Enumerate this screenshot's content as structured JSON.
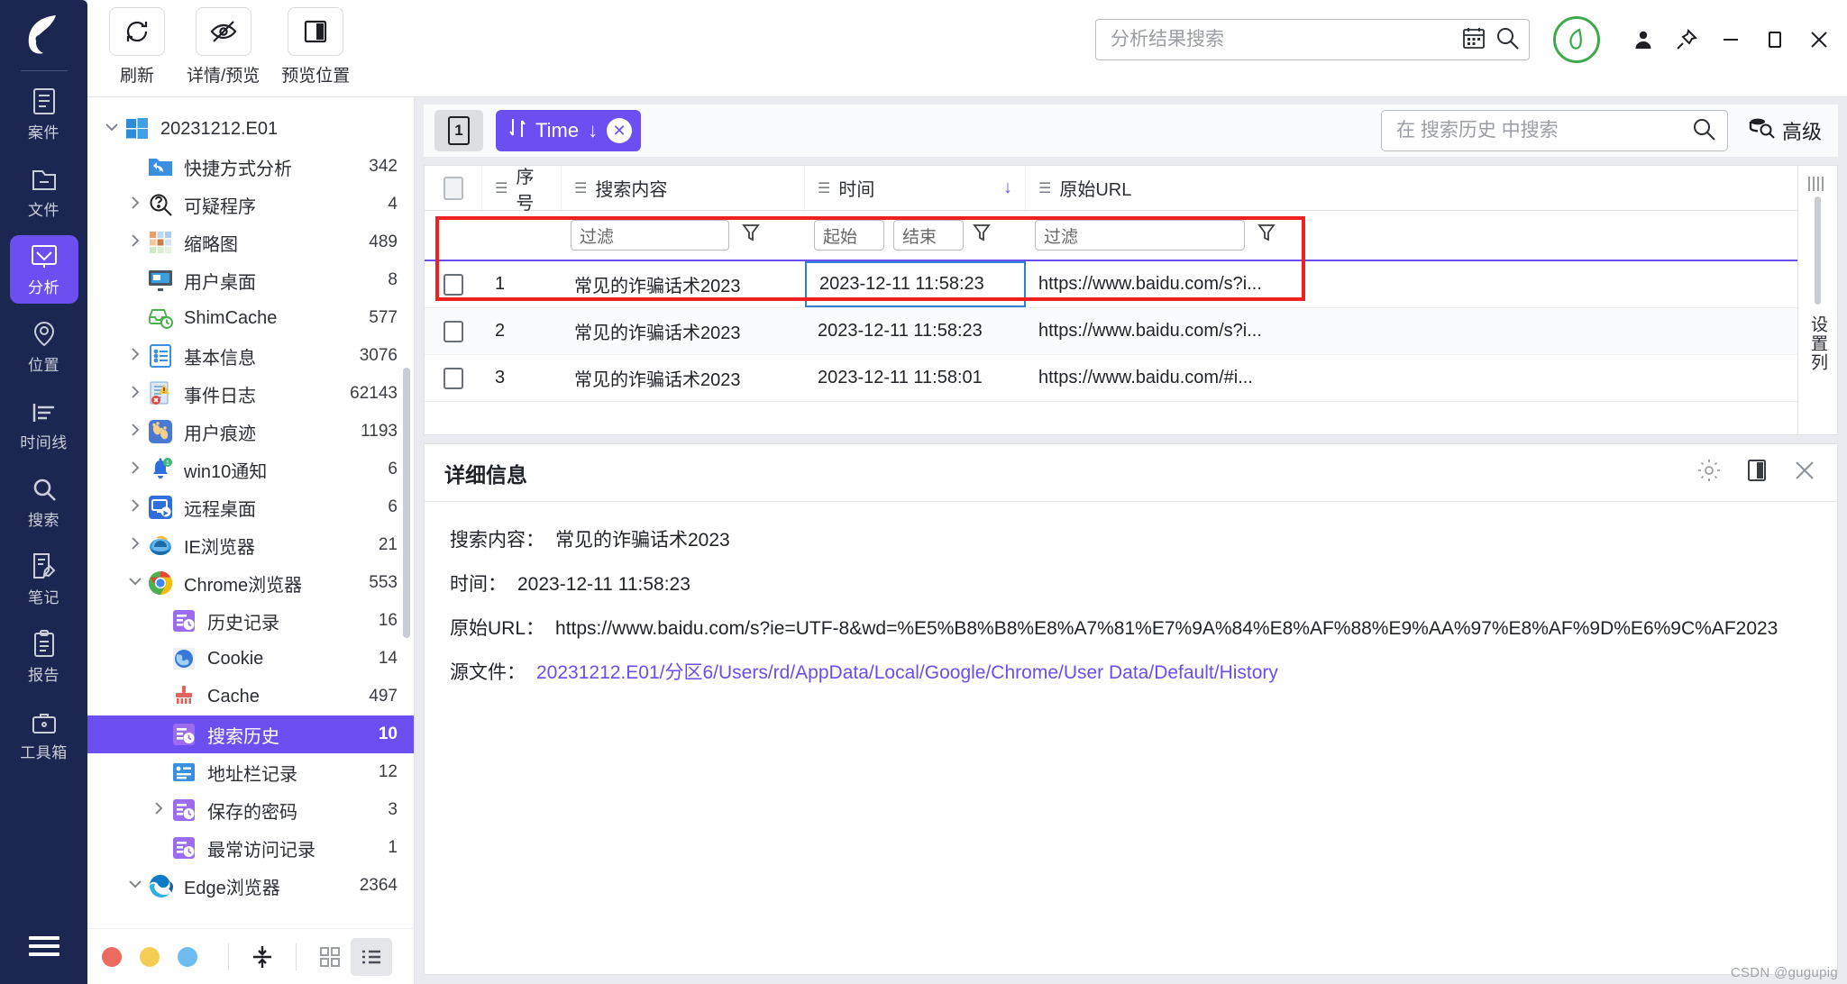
{
  "rail": {
    "logo_icon": "app-logo-icon",
    "items": [
      {
        "label": "案件",
        "icon": "clipboard-icon",
        "active": false
      },
      {
        "label": "文件",
        "icon": "folder-minus-icon",
        "active": false
      },
      {
        "label": "分析",
        "icon": "analysis-chart-icon",
        "active": true
      },
      {
        "label": "位置",
        "icon": "location-pin-icon",
        "active": false
      },
      {
        "label": "时间线",
        "icon": "timeline-icon",
        "active": false
      },
      {
        "label": "搜索",
        "icon": "search-icon",
        "active": false
      },
      {
        "label": "笔记",
        "icon": "note-pencil-icon",
        "active": false
      },
      {
        "label": "报告",
        "icon": "report-clipboard-icon",
        "active": false
      },
      {
        "label": "工具箱",
        "icon": "toolbox-icon",
        "active": false
      }
    ],
    "menu_icon": "hamburger-menu-icon"
  },
  "titlebar": {
    "tools": [
      {
        "label": "刷新",
        "icon": "refresh-icon"
      },
      {
        "label": "详情/预览",
        "icon": "eye-off-icon"
      },
      {
        "label": "预览位置",
        "icon": "panel-layout-icon"
      }
    ],
    "global_search": {
      "placeholder": "分析结果搜索",
      "value": "",
      "calendar_icon": "calendar-icon",
      "search_icon": "search-icon"
    },
    "status_icon": "green-leaf-badge-icon",
    "window_controls": [
      {
        "name": "account-icon",
        "glyph": "person"
      },
      {
        "name": "pin-icon",
        "glyph": "pin"
      },
      {
        "name": "minimize-icon",
        "glyph": "minus"
      },
      {
        "name": "maximize-icon",
        "glyph": "square"
      },
      {
        "name": "close-icon",
        "glyph": "x"
      }
    ]
  },
  "tree": {
    "nodes": [
      {
        "label": "20231212.E01",
        "count": "",
        "caret": "down",
        "indent": 0,
        "icon": "windows-icon",
        "selected": false
      },
      {
        "label": "快捷方式分析",
        "count": "342",
        "caret": "none",
        "indent": 1,
        "icon": "shortcut-folder-icon",
        "selected": false
      },
      {
        "label": "可疑程序",
        "count": "4",
        "caret": "right",
        "indent": 1,
        "icon": "suspicious-program-icon",
        "selected": false
      },
      {
        "label": "缩略图",
        "count": "489",
        "caret": "right",
        "indent": 1,
        "icon": "thumbnail-grid-icon",
        "selected": false
      },
      {
        "label": "用户桌面",
        "count": "8",
        "caret": "none",
        "indent": 1,
        "icon": "desktop-icon",
        "selected": false
      },
      {
        "label": "ShimCache",
        "count": "577",
        "caret": "none",
        "indent": 1,
        "icon": "shimcache-icon",
        "selected": false
      },
      {
        "label": "基本信息",
        "count": "3076",
        "caret": "right",
        "indent": 1,
        "icon": "basic-info-icon",
        "selected": false
      },
      {
        "label": "事件日志",
        "count": "62143",
        "caret": "right",
        "indent": 1,
        "icon": "event-log-icon",
        "selected": false
      },
      {
        "label": "用户痕迹",
        "count": "1193",
        "caret": "right",
        "indent": 1,
        "icon": "footprints-icon",
        "selected": false
      },
      {
        "label": "win10通知",
        "count": "6",
        "caret": "right",
        "indent": 1,
        "icon": "bell-icon",
        "selected": false
      },
      {
        "label": "远程桌面",
        "count": "6",
        "caret": "right",
        "indent": 1,
        "icon": "remote-desktop-icon",
        "selected": false
      },
      {
        "label": "IE浏览器",
        "count": "21",
        "caret": "right",
        "indent": 1,
        "icon": "ie-browser-icon",
        "selected": false
      },
      {
        "label": "Chrome浏览器",
        "count": "553",
        "caret": "down",
        "indent": 1,
        "icon": "chrome-icon",
        "selected": false
      },
      {
        "label": "历史记录",
        "count": "16",
        "caret": "none",
        "indent": 2,
        "icon": "history-icon",
        "selected": false
      },
      {
        "label": "Cookie",
        "count": "14",
        "caret": "none",
        "indent": 2,
        "icon": "cookie-globe-icon",
        "selected": false
      },
      {
        "label": "Cache",
        "count": "497",
        "caret": "none",
        "indent": 2,
        "icon": "cache-broom-icon",
        "selected": false
      },
      {
        "label": "搜索历史",
        "count": "10",
        "caret": "none",
        "indent": 2,
        "icon": "search-history-icon",
        "selected": true
      },
      {
        "label": "地址栏记录",
        "count": "12",
        "caret": "none",
        "indent": 2,
        "icon": "address-bar-icon",
        "selected": false
      },
      {
        "label": "保存的密码",
        "count": "3",
        "caret": "right",
        "indent": 2,
        "icon": "saved-password-icon",
        "selected": false
      },
      {
        "label": "最常访问记录",
        "count": "1",
        "caret": "none",
        "indent": 2,
        "icon": "top-sites-icon",
        "selected": false
      },
      {
        "label": "Edge浏览器",
        "count": "2364",
        "caret": "down",
        "indent": 1,
        "icon": "edge-icon",
        "selected": false
      }
    ],
    "footer": {
      "dots": [
        "#ec6b5e",
        "#f5cd52",
        "#6fbdf0"
      ],
      "buttons": [
        {
          "name": "collapse-expand-button",
          "active": false
        },
        {
          "name": "grid-view-button",
          "active": false
        },
        {
          "name": "list-view-button",
          "active": true
        }
      ]
    }
  },
  "toolstrip": {
    "page_button_label": "1",
    "sort_chip": {
      "label": "Time",
      "direction_icon": "sort-desc-icon",
      "arrow": "↓",
      "close": "✕"
    },
    "local_search": {
      "placeholder": "在 搜索历史 中搜索",
      "value": "",
      "icon": "search-icon"
    },
    "advanced": {
      "label": "高级",
      "icon": "advanced-search-icon"
    }
  },
  "table": {
    "columns": [
      {
        "key": "chk",
        "label": ""
      },
      {
        "key": "idx",
        "label": "序号"
      },
      {
        "key": "query",
        "label": "搜索内容"
      },
      {
        "key": "time",
        "label": "时间"
      },
      {
        "key": "url",
        "label": "原始URL"
      }
    ],
    "sorted_column": "时间",
    "sort_arrow": "↓",
    "filters": {
      "query_placeholder": "过滤",
      "time_start_placeholder": "起始",
      "time_end_placeholder": "结束",
      "url_placeholder": "过滤",
      "funnel_icon": "funnel-icon"
    },
    "rows": [
      {
        "idx": "1",
        "query": "常见的诈骗话术2023",
        "time": "2023-12-11 11:58:23",
        "url": "https://www.baidu.com/s?i..."
      },
      {
        "idx": "2",
        "query": "常见的诈骗话术2023",
        "time": "2023-12-11 11:58:23",
        "url": "https://www.baidu.com/s?i..."
      },
      {
        "idx": "3",
        "query": "常见的诈骗话术2023",
        "time": "2023-12-11 11:58:01",
        "url": "https://www.baidu.com/#i..."
      }
    ],
    "side_label": "设置列"
  },
  "detail": {
    "title": "详细信息",
    "icons": [
      {
        "name": "gear-icon"
      },
      {
        "name": "panel-layout-icon"
      },
      {
        "name": "close-icon"
      }
    ],
    "fields": [
      {
        "label": "搜索内容：",
        "value": "常见的诈骗话术2023",
        "link": false
      },
      {
        "label": "时间：",
        "value": "2023-12-11 11:58:23",
        "link": false
      },
      {
        "label": "原始URL：",
        "value": "https://www.baidu.com/s?ie=UTF-8&wd=%E5%B8%B8%E8%A7%81%E7%9A%84%E8%AF%88%E9%AA%97%E8%AF%9D%E6%9C%AF2023",
        "link": false
      },
      {
        "label": "源文件：",
        "value": "20231212.E01/分区6/Users/rd/AppData/Local/Google/Chrome/User Data/Default/History",
        "link": true
      }
    ]
  },
  "watermark": "CSDN @gugupig",
  "colors": {
    "accent": "#6c4ff0",
    "rail_bg": "#1b2750",
    "highlight_red": "#ef2020",
    "link": "#6a4df0",
    "green": "#3ea94b"
  }
}
